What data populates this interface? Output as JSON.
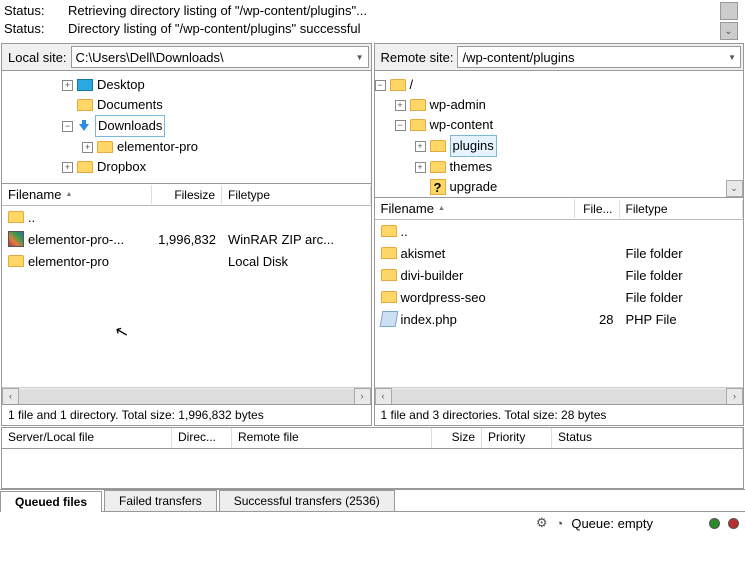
{
  "status": {
    "label": "Status:",
    "lines": [
      "Retrieving directory listing of \"/wp-content/plugins\"...",
      "Directory listing of \"/wp-content/plugins\" successful"
    ]
  },
  "local": {
    "label": "Local site:",
    "path": "C:\\Users\\Dell\\Downloads\\",
    "tree": [
      {
        "level": 3,
        "expander": "+",
        "icon": "desktop",
        "label": "Desktop"
      },
      {
        "level": 3,
        "expander": "",
        "icon": "folder",
        "label": "Documents"
      },
      {
        "level": 3,
        "expander": "-",
        "icon": "downloads",
        "label": "Downloads",
        "selected": true
      },
      {
        "level": 4,
        "expander": "+",
        "icon": "folder",
        "label": "elementor-pro"
      },
      {
        "level": 3,
        "expander": "+",
        "icon": "folder",
        "label": "Dropbox"
      }
    ],
    "columns": {
      "filename": "Filename",
      "filesize": "Filesize",
      "filetype": "Filetype"
    },
    "rows": [
      {
        "icon": "folder",
        "name": "..",
        "size": "",
        "type": ""
      },
      {
        "icon": "zip",
        "name": "elementor-pro-...",
        "size": "1,996,832",
        "type": "WinRAR ZIP arc..."
      },
      {
        "icon": "folder",
        "name": "elementor-pro",
        "size": "",
        "type": "Local Disk"
      }
    ],
    "statusbar": "1 file and 1 directory. Total size: 1,996,832 bytes"
  },
  "remote": {
    "label": "Remote site:",
    "path": "/wp-content/plugins",
    "tree": [
      {
        "level": 0,
        "expander": "-",
        "icon": "folder",
        "label": "/"
      },
      {
        "level": 1,
        "expander": "+",
        "icon": "folder",
        "label": "wp-admin"
      },
      {
        "level": 1,
        "expander": "-",
        "icon": "folder",
        "label": "wp-content"
      },
      {
        "level": 2,
        "expander": "+",
        "icon": "folder",
        "label": "plugins",
        "selected": true
      },
      {
        "level": 2,
        "expander": "+",
        "icon": "folder",
        "label": "themes"
      },
      {
        "level": 2,
        "expander": "",
        "icon": "question",
        "label": "upgrade"
      }
    ],
    "columns": {
      "filename": "Filename",
      "filesize": "File...",
      "filetype": "Filetype"
    },
    "rows": [
      {
        "icon": "folder",
        "name": "..",
        "size": "",
        "type": ""
      },
      {
        "icon": "folder",
        "name": "akismet",
        "size": "",
        "type": "File folder"
      },
      {
        "icon": "folder",
        "name": "divi-builder",
        "size": "",
        "type": "File folder"
      },
      {
        "icon": "folder",
        "name": "wordpress-seo",
        "size": "",
        "type": "File folder"
      },
      {
        "icon": "php",
        "name": "index.php",
        "size": "28",
        "type": "PHP File"
      }
    ],
    "statusbar": "1 file and 3 directories. Total size: 28 bytes"
  },
  "queue": {
    "columns": {
      "serverlocal": "Server/Local file",
      "direction": "Direc...",
      "remote": "Remote file",
      "size": "Size",
      "priority": "Priority",
      "status": "Status"
    },
    "tabs": {
      "queued": "Queued files",
      "failed": "Failed transfers",
      "successful": "Successful transfers (2536)"
    }
  },
  "bottom": {
    "queue_text": "Queue: empty"
  }
}
